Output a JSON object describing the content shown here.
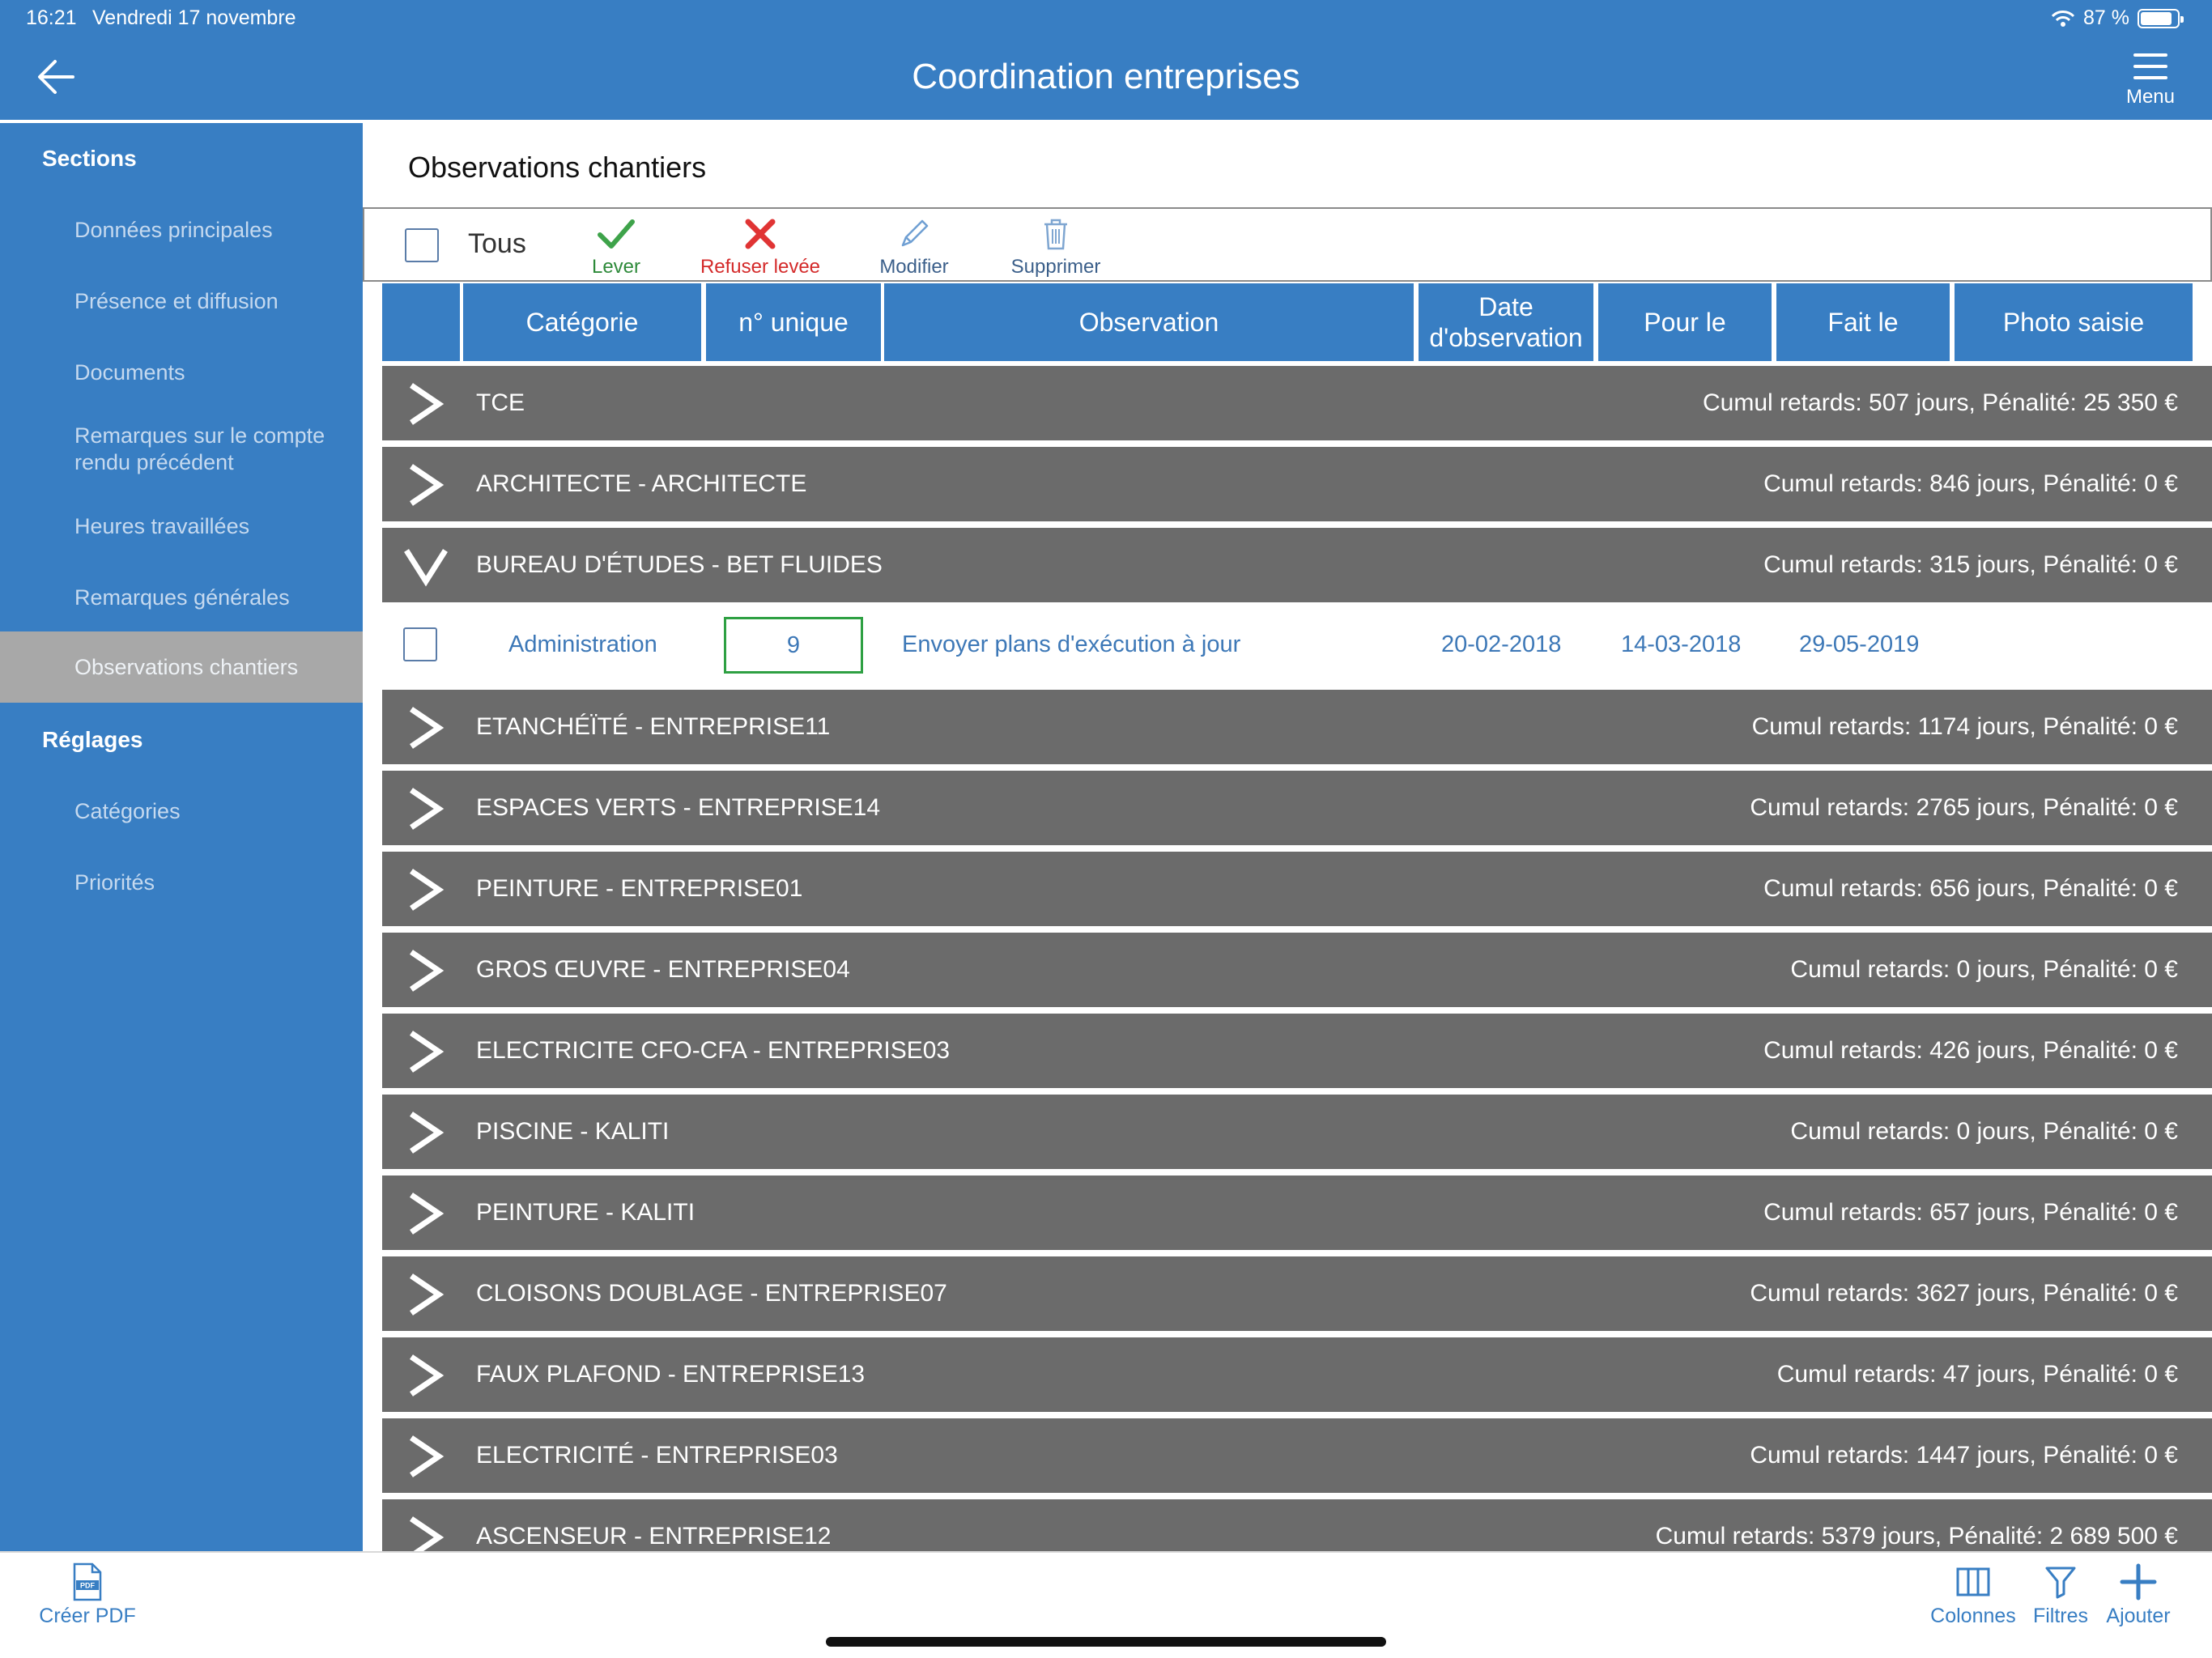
{
  "status": {
    "time": "16:21",
    "date": "Vendredi 17 novembre",
    "battery": "87 %",
    "battery_level": 0.87
  },
  "header": {
    "title": "Coordination entreprises",
    "menu_label": "Menu"
  },
  "sidebar": {
    "sections_title": "Sections",
    "sections": [
      {
        "label": "Données principales"
      },
      {
        "label": "Présence et diffusion"
      },
      {
        "label": "Documents"
      },
      {
        "label": "Remarques sur le compte rendu précédent"
      },
      {
        "label": "Heures travaillées"
      },
      {
        "label": "Remarques générales"
      },
      {
        "label": "Observations chantiers",
        "active": true
      }
    ],
    "settings_title": "Réglages",
    "settings": [
      {
        "label": "Catégories"
      },
      {
        "label": "Priorités"
      }
    ]
  },
  "main": {
    "title": "Observations chantiers",
    "toolbar": {
      "all_label": "Tous",
      "lever_label": "Lever",
      "refuser_label": "Refuser levée",
      "modifier_label": "Modifier",
      "supprimer_label": "Supprimer"
    },
    "columns": [
      "Catégorie",
      "n° unique",
      "Observation",
      "Date d'observation",
      "Pour le",
      "Fait le",
      "Photo saisie"
    ],
    "groups": [
      {
        "name": "TCE",
        "stats": "Cumul retards: 507 jours, Pénalité: 25 350 €"
      },
      {
        "name": "ARCHITECTE - ARCHITECTE",
        "stats": "Cumul retards: 846 jours, Pénalité: 0 €"
      },
      {
        "name": "BUREAU D'ÉTUDES - BET FLUIDES",
        "stats": "Cumul retards: 315 jours, Pénalité: 0 €"
      },
      {
        "name": "ETANCHÉÏTÉ - ENTREPRISE11",
        "stats": "Cumul retards: 1174 jours, Pénalité: 0 €"
      },
      {
        "name": "ESPACES VERTS - ENTREPRISE14",
        "stats": "Cumul retards: 2765 jours, Pénalité: 0 €"
      },
      {
        "name": "PEINTURE - ENTREPRISE01",
        "stats": "Cumul retards: 656 jours, Pénalité: 0 €"
      },
      {
        "name": "GROS ŒUVRE - ENTREPRISE04",
        "stats": "Cumul retards: 0 jours, Pénalité: 0 €"
      },
      {
        "name": "ELECTRICITE CFO-CFA - ENTREPRISE03",
        "stats": "Cumul retards: 426 jours, Pénalité: 0 €"
      },
      {
        "name": "PISCINE - KALITI",
        "stats": "Cumul retards: 0 jours, Pénalité: 0 €"
      },
      {
        "name": "PEINTURE - KALITI",
        "stats": "Cumul retards: 657 jours, Pénalité: 0 €"
      },
      {
        "name": "CLOISONS DOUBLAGE - ENTREPRISE07",
        "stats": "Cumul retards: 3627 jours, Pénalité: 0 €"
      },
      {
        "name": "FAUX PLAFOND - ENTREPRISE13",
        "stats": "Cumul retards: 47 jours, Pénalité: 0 €"
      },
      {
        "name": "ELECTRICITÉ - ENTREPRISE03",
        "stats": "Cumul retards: 1447 jours, Pénalité: 0 €"
      },
      {
        "name": "ASCENSEUR - ENTREPRISE12",
        "stats": "Cumul retards: 5379 jours, Pénalité: 2 689 500 €"
      }
    ],
    "row": {
      "category": "Administration",
      "number": "9",
      "observation": "Envoyer plans d'exécution à jour",
      "date_observation": "20-02-2018",
      "pour_le": "14-03-2018",
      "fait_le": "29-05-2019"
    }
  },
  "bottom": {
    "pdf_label": "Créer PDF",
    "pdf_icon_text": "PDF",
    "columns_label": "Colonnes",
    "filters_label": "Filtres",
    "add_label": "Ajouter"
  },
  "colors": {
    "brand": "#387ec3",
    "group_bg": "#6b6b6b",
    "success": "#3ea34a",
    "danger": "#e03434",
    "active_item": "#a8a8a8"
  }
}
